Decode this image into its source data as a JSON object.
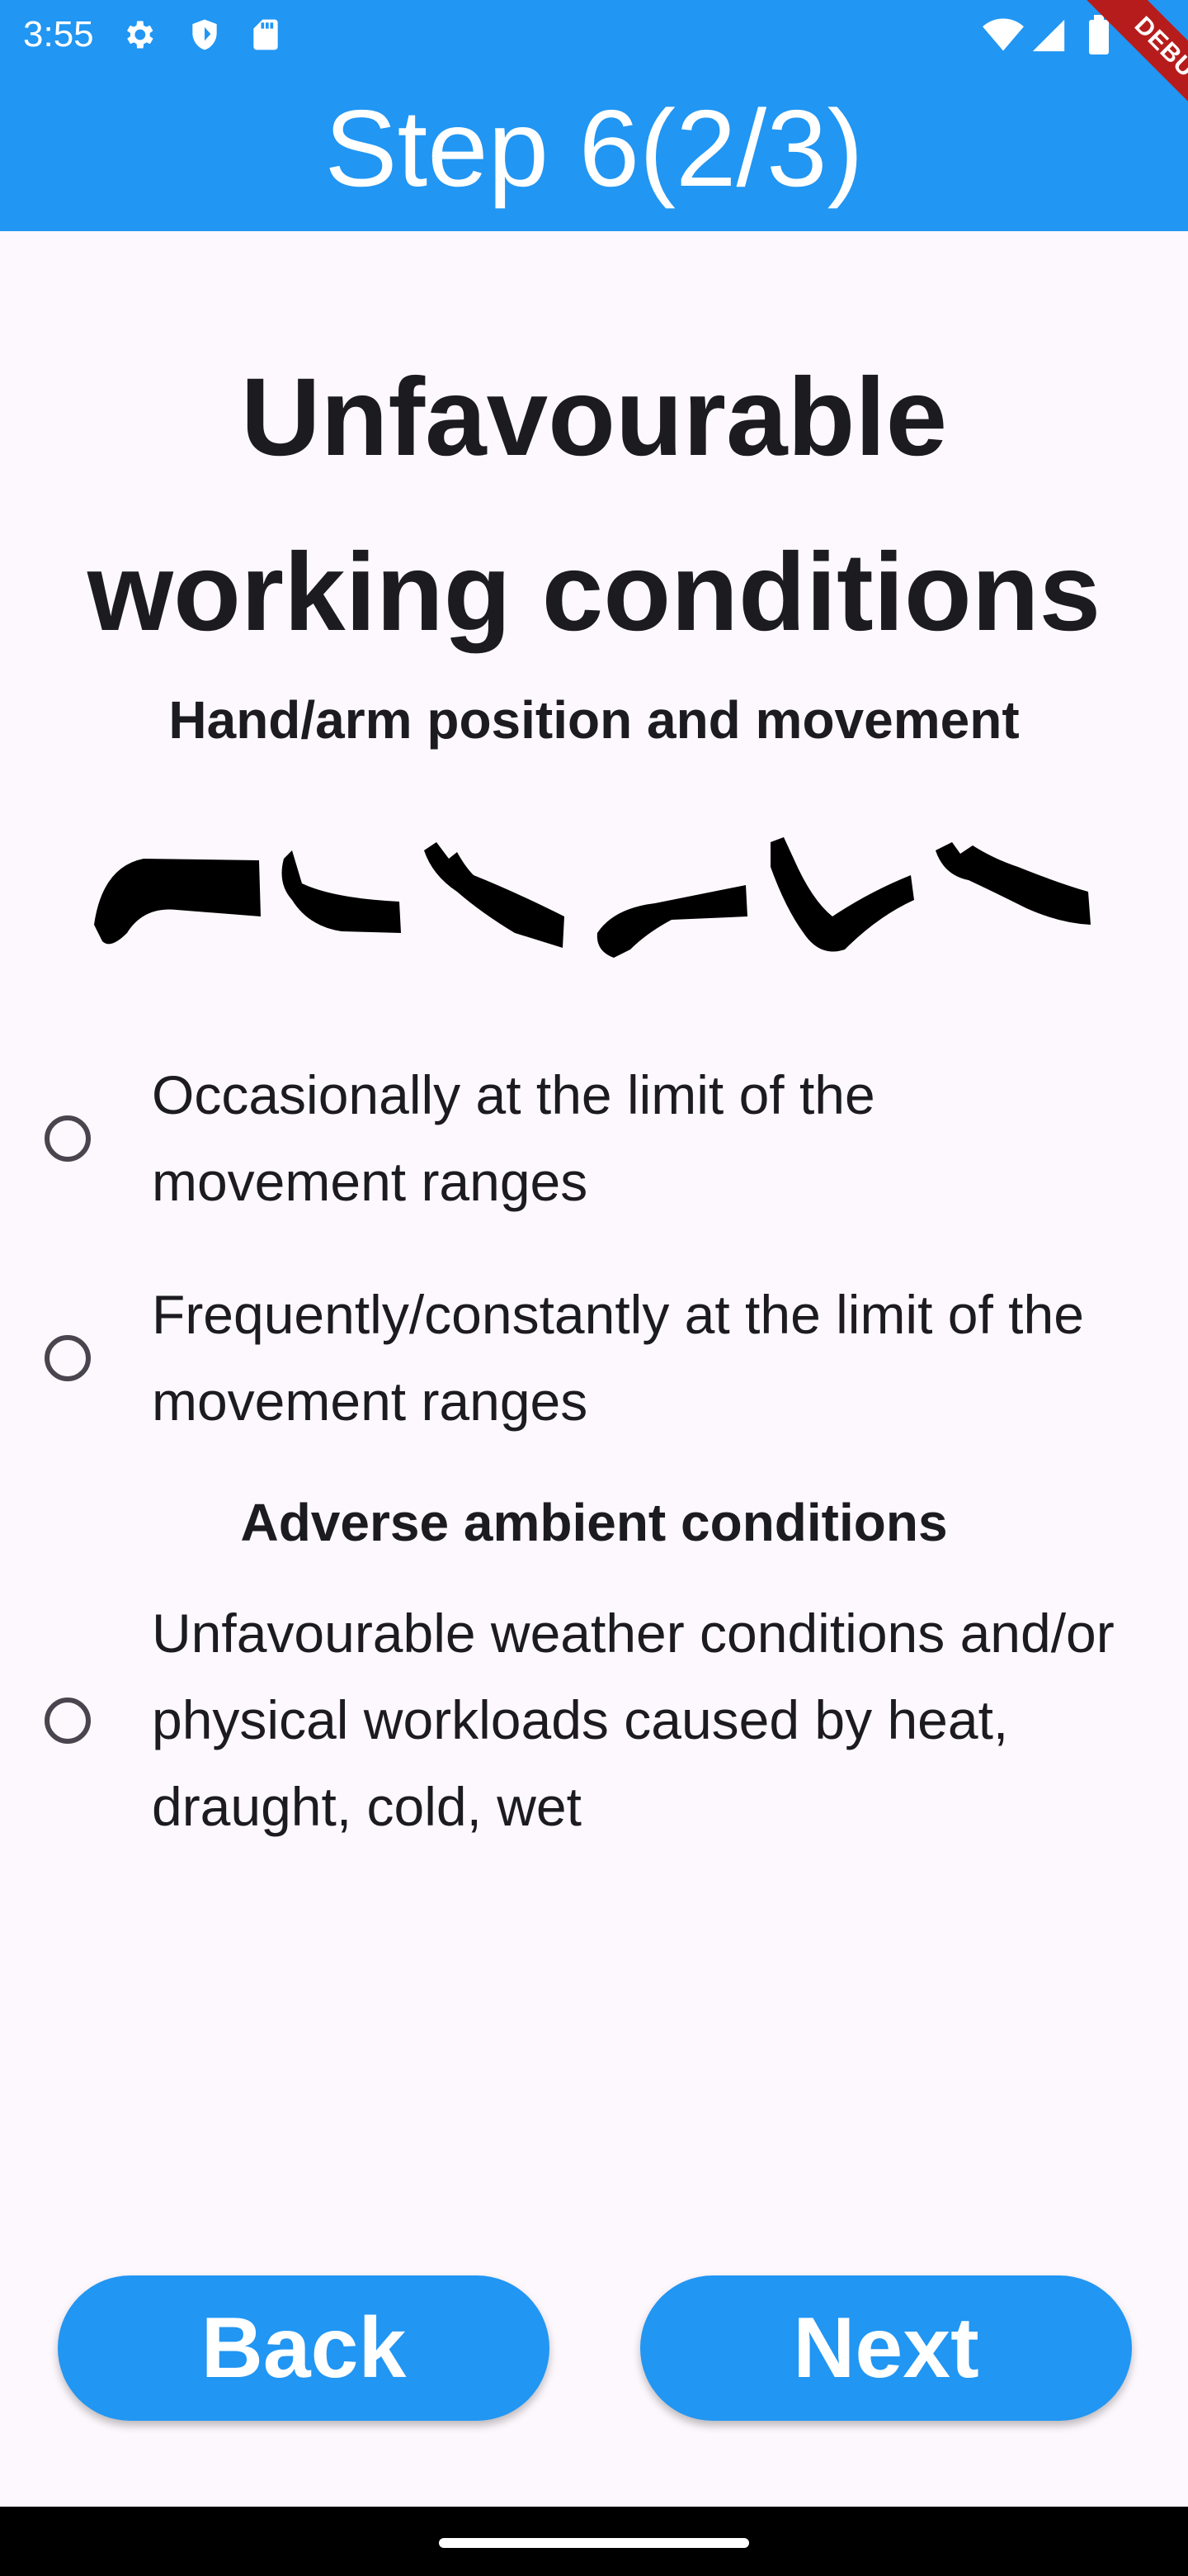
{
  "status_bar": {
    "time": "3:55",
    "left_icons": [
      "gear-icon",
      "shield-icon",
      "sd-card-icon"
    ],
    "right_icons": [
      "wifi-icon",
      "cell-signal-icon",
      "battery-icon"
    ]
  },
  "debug_banner": "DEBUG",
  "app_bar": {
    "title": "Step 6(2/3)",
    "color": "#2196f3"
  },
  "page": {
    "title": "Unfavourable working conditions",
    "sections": [
      {
        "heading": "Hand/arm position and movement",
        "illustration": "arm-positions-illustration",
        "options": [
          {
            "label": "Occasionally at the limit of the movement ranges",
            "selected": false
          },
          {
            "label": "Frequently/constantly at the limit of the movement ranges",
            "selected": false
          }
        ]
      },
      {
        "heading": "Adverse ambient conditions",
        "options": [
          {
            "label": "Unfavourable weather conditions and/or physical workloads caused by heat, draught, cold, wet",
            "selected": false
          }
        ]
      }
    ]
  },
  "buttons": {
    "back": "Back",
    "next": "Next"
  }
}
